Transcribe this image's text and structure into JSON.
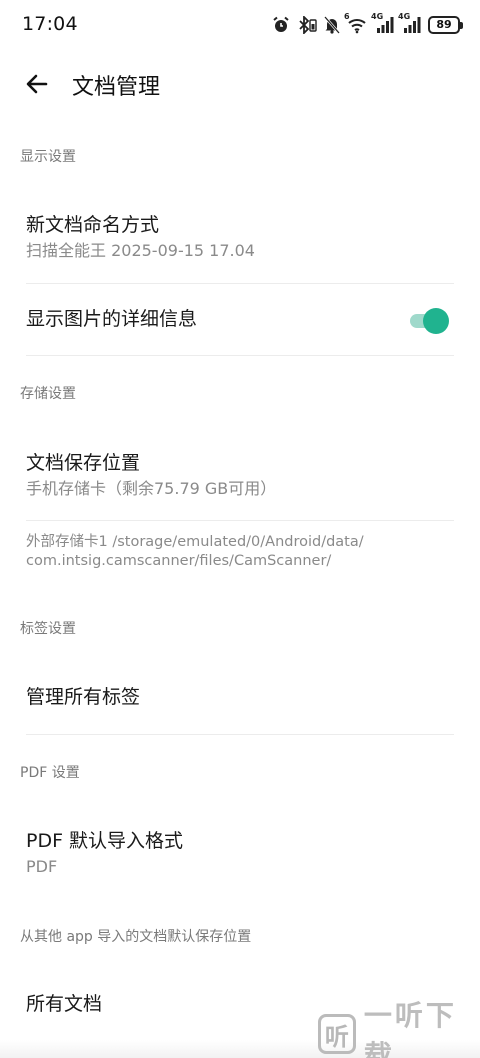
{
  "status_bar": {
    "time": "17:04",
    "battery": "89",
    "signal1_label": "4G",
    "signal2_label": "4G",
    "wifi_label": "6"
  },
  "header": {
    "title": "文档管理"
  },
  "sections": {
    "display": {
      "label": "显示设置",
      "naming_title": "新文档命名方式",
      "naming_value": "扫描全能王 2025-09-15 17.04",
      "show_details_title": "显示图片的详细信息",
      "show_details_enabled": true
    },
    "storage": {
      "label": "存储设置",
      "location_title": "文档保存位置",
      "location_value": "手机存储卡（剩余75.79 GB可用）",
      "external_path_line1": "外部存储卡1 /storage/emulated/0/Android/data/",
      "external_path_line2": "com.intsig.camscanner/files/CamScanner/"
    },
    "tags": {
      "label": "标签设置",
      "manage_title": "管理所有标签"
    },
    "pdf": {
      "label": "PDF 设置",
      "import_format_title": "PDF 默认导入格式",
      "import_format_value": "PDF"
    },
    "import_location": {
      "label": "从其他 app 导入的文档默认保存位置",
      "all_docs_title": "所有文档"
    }
  },
  "watermark": {
    "logo_char": "听",
    "text": "一听下载"
  },
  "colors": {
    "accent": "#20b38f",
    "accent_track": "#9fd9cb",
    "secondary_text": "#8a8a8a"
  }
}
